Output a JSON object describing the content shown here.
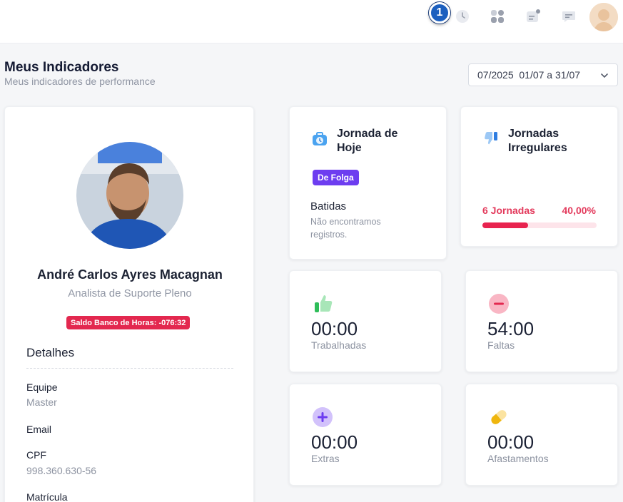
{
  "topbar": {
    "badge": "1",
    "icons": [
      "clock-icon",
      "apps-grid-icon",
      "inbox-notification-icon",
      "chat-icon",
      "user-avatar"
    ]
  },
  "header": {
    "title": "Meus Indicadores",
    "subtitle": "Meus indicadores de performance",
    "period": "07/2025  01/07 a 31/07"
  },
  "profile": {
    "name": "André Carlos Ayres Macagnan",
    "role": "Analista de Suporte Pleno",
    "saldo": "Saldo Banco de Horas: -076:32",
    "details_title": "Detalhes",
    "details": [
      {
        "label": "Equipe",
        "value": "Master"
      },
      {
        "label": "Email",
        "value": ""
      },
      {
        "label": "CPF",
        "value": "998.360.630-56"
      },
      {
        "label": "Matrícula",
        "value": ""
      }
    ]
  },
  "jornada_hoje": {
    "title": "Jornada de Hoje",
    "status": "De Folga",
    "batidas_title": "Batidas",
    "batidas_text": "Não encontramos registros."
  },
  "jornadas_irregulares": {
    "title": "Jornadas Irregulares",
    "count": "6 Jornadas",
    "percent": "40,00%",
    "progress": 0.4
  },
  "stats": {
    "trabalhadas": {
      "value": "00:00",
      "label": "Trabalhadas"
    },
    "faltas": {
      "value": "54:00",
      "label": "Faltas"
    },
    "extras": {
      "value": "00:00",
      "label": "Extras"
    },
    "afastamentos": {
      "value": "00:00",
      "label": "Afastamentos"
    }
  },
  "colors": {
    "accent_purple": "#6d3df0",
    "danger": "#e3284f",
    "success": "#33c25c",
    "primary_blue": "#1b5fbf"
  }
}
